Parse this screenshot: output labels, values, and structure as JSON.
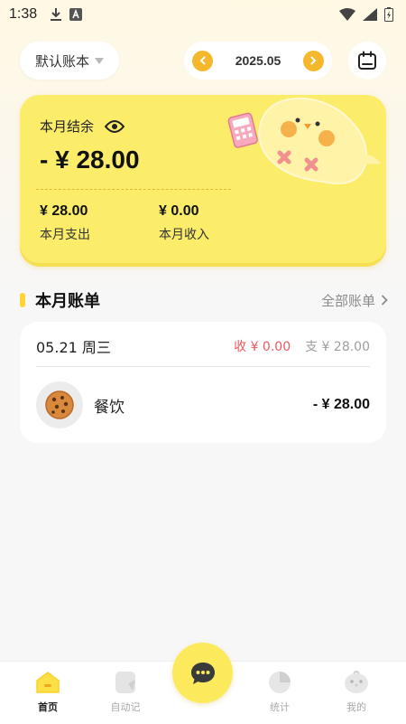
{
  "status_bar": {
    "time": "1:38"
  },
  "header": {
    "account_book": "默认账本",
    "month": "2025.05"
  },
  "summary": {
    "balance_label": "本月结余",
    "balance_value": "- ¥ 28.00",
    "expense_value": "¥ 28.00",
    "expense_label": "本月支出",
    "income_value": "¥ 0.00",
    "income_label": "本月收入"
  },
  "bills_section": {
    "title": "本月账单",
    "all_link": "全部账单"
  },
  "bill_days": [
    {
      "date": "05.21 周三",
      "income": "收 ¥ 0.00",
      "expense": "支 ¥ 28.00",
      "items": [
        {
          "name": "餐饮",
          "amount": "- ¥ 28.00",
          "icon": "cookie-icon"
        }
      ]
    }
  ],
  "bottom_nav": {
    "items": [
      {
        "label": "首页",
        "icon": "home-icon",
        "active": true
      },
      {
        "label": "自动记",
        "icon": "note-icon",
        "active": false
      },
      {
        "label": "统计",
        "icon": "pie-chart-icon",
        "active": false
      },
      {
        "label": "我的",
        "icon": "bird-profile-icon",
        "active": false
      }
    ],
    "fab_icon": "chat-bubble-icon"
  },
  "colors": {
    "accent_yellow": "#fbec6a",
    "arrow_orange": "#f5b72b",
    "income_red": "#f0575e",
    "expense_gray": "#9e9e9e"
  }
}
